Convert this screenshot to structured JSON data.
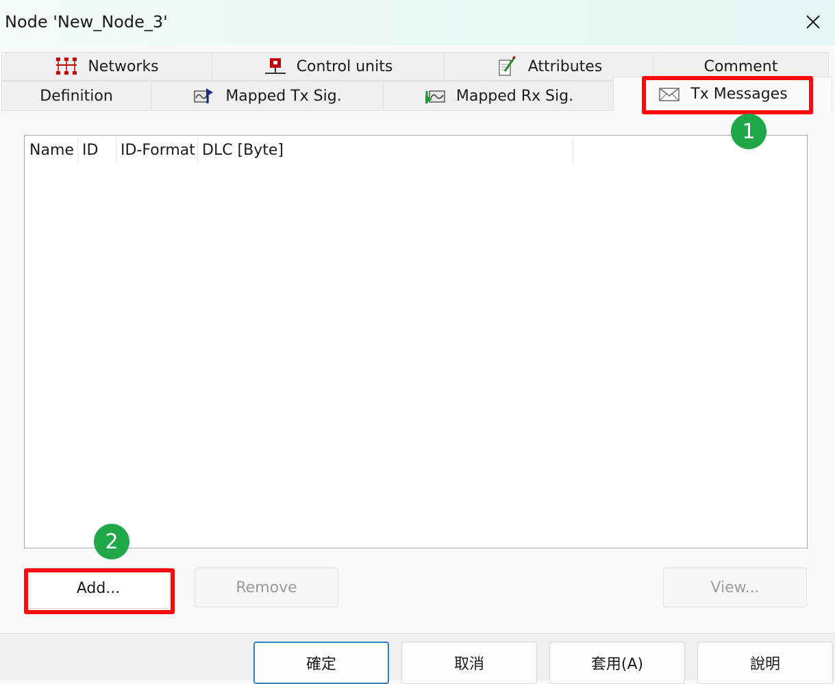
{
  "window": {
    "title": "Node 'New_Node_3'"
  },
  "tabs": {
    "row_back": [
      {
        "label": "Networks",
        "icon": "networks-icon"
      },
      {
        "label": "Control units",
        "icon": "control-units-icon"
      },
      {
        "label": "Attributes",
        "icon": "attributes-icon"
      },
      {
        "label": "Comment",
        "icon": ""
      }
    ],
    "row_front": [
      {
        "label": "Definition",
        "icon": ""
      },
      {
        "label": "Mapped Tx Sig.",
        "icon": "mapped-tx-signal-icon"
      },
      {
        "label": "Mapped Rx Sig.",
        "icon": "mapped-rx-signal-icon"
      },
      {
        "label": "Tx Messages",
        "icon": "envelope-icon",
        "active": true
      }
    ]
  },
  "list": {
    "columns": [
      "Name",
      "ID",
      "ID-Format",
      "DLC [Byte]",
      ""
    ],
    "rows": []
  },
  "actions": {
    "add": "Add...",
    "remove": "Remove",
    "view": "View..."
  },
  "dialog_buttons": {
    "ok": "確定",
    "cancel": "取消",
    "apply": "套用(A)",
    "help": "說明"
  },
  "annotations": {
    "step1": "1",
    "step2": "2"
  },
  "colors": {
    "highlight": "#ff0a0a",
    "badge": "#1ea84a",
    "accent": "#2f7fc4"
  }
}
